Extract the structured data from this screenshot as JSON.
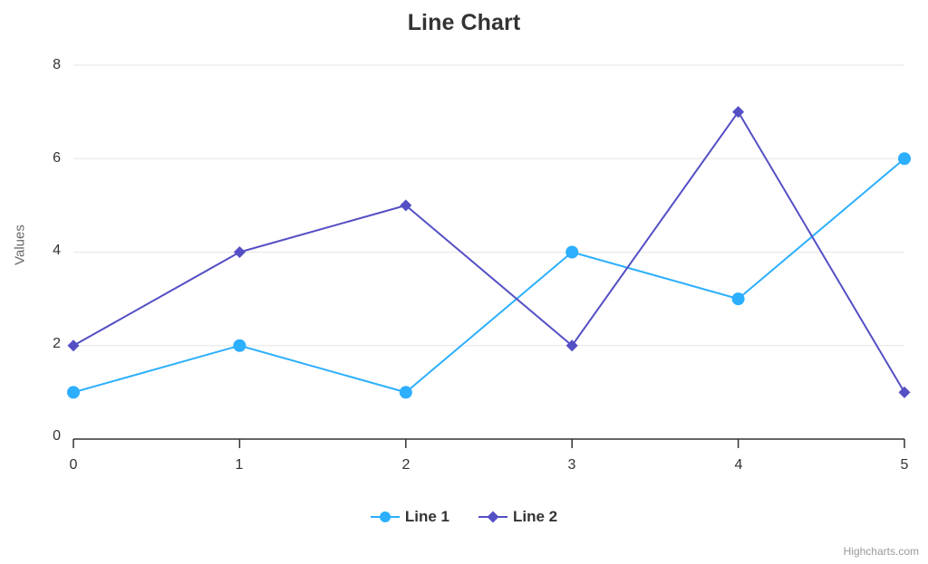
{
  "chart_data": {
    "type": "line",
    "title": "Line Chart",
    "xlabel": "",
    "ylabel": "Values",
    "x": [
      0,
      1,
      2,
      3,
      4,
      5
    ],
    "categories": [
      "0",
      "1",
      "2",
      "3",
      "4",
      "5"
    ],
    "xlim": [
      0,
      5
    ],
    "ylim": [
      0,
      8
    ],
    "x_ticks": [
      "0",
      "1",
      "2",
      "3",
      "4",
      "5"
    ],
    "y_ticks": [
      "0",
      "2",
      "4",
      "6",
      "8"
    ],
    "grid": "horizontal",
    "legend_position": "bottom-center",
    "series": [
      {
        "name": "Line 1",
        "color": "#2caffe",
        "marker": "circle",
        "values": [
          1,
          2,
          1,
          4,
          3,
          6
        ]
      },
      {
        "name": "Line 2",
        "color": "#544fc5",
        "marker": "diamond",
        "values": [
          2,
          4,
          5,
          2,
          7,
          1
        ]
      }
    ]
  },
  "credits": {
    "text": "Highcharts.com"
  },
  "colors": {
    "title": "#333333",
    "axis_label": "#333333",
    "axis_title": "#666666",
    "gridline": "#e6e6e6",
    "axis_line": "#333333",
    "credits": "#999999",
    "background": "#ffffff"
  }
}
